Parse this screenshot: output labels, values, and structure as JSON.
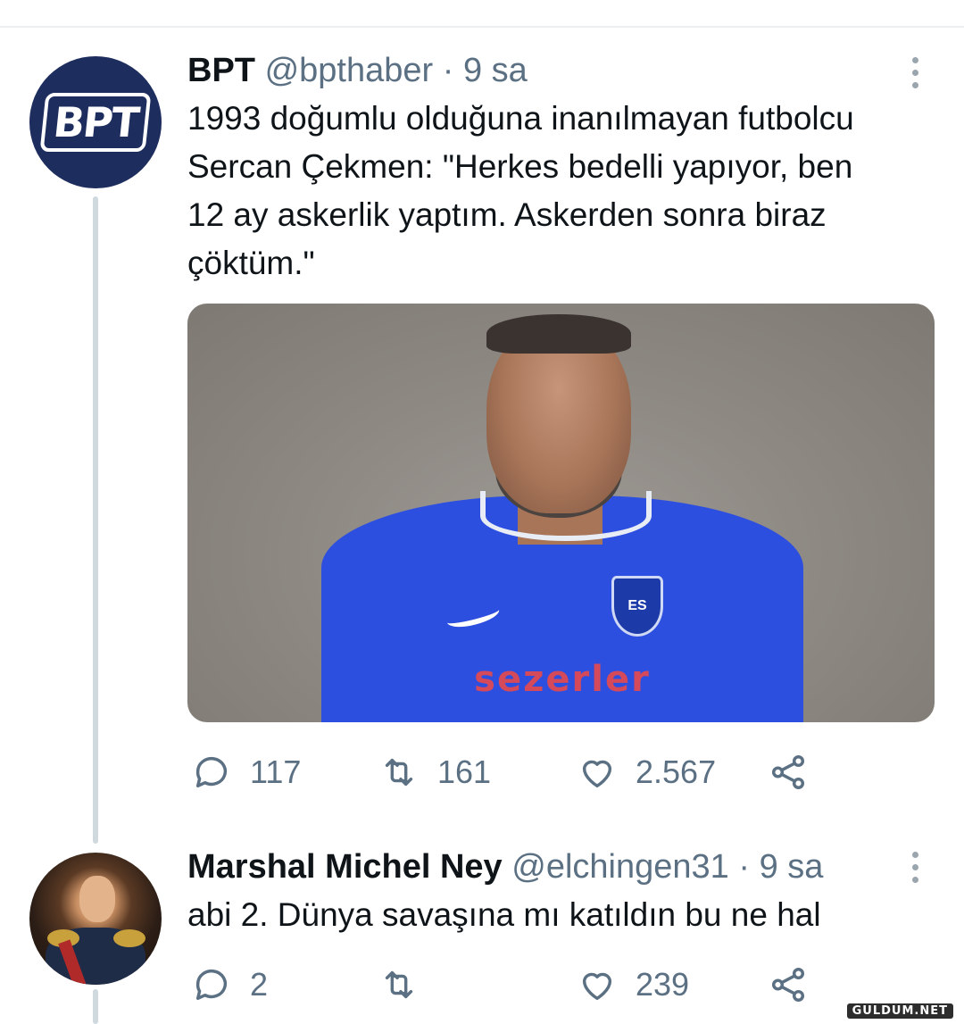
{
  "tweets": [
    {
      "name": "BPT",
      "handle": "@bpthaber",
      "time": "9 sa",
      "avatar_text": "BPT",
      "text": "1993 doğumlu olduğuna inanılmayan futbolcu\nSercan Çekmen: \"Herkes bedelli yapıyor, ben\n12 ay askerlik yaptım. Askerden sonra biraz\nçöktüm.\"",
      "media": {
        "jersey_logo": "ES",
        "sponsor": "sezerler"
      },
      "actions": {
        "replies": "117",
        "retweets": "161",
        "likes": "2.567"
      }
    },
    {
      "name": "Marshal Michel Ney",
      "handle": "@elchingen31",
      "time": "9 sa",
      "text": "abi 2. Dünya savaşına mı katıldın bu ne hal",
      "actions": {
        "replies": "2",
        "retweets": "",
        "likes": "239"
      }
    }
  ],
  "separator": " · ",
  "watermark": "GULDUM.NET",
  "colors": {
    "text": "#0f1419",
    "secondary": "#5b7083",
    "thread_line": "#cfd9de",
    "bpt_avatar": "#1d2d5e"
  }
}
